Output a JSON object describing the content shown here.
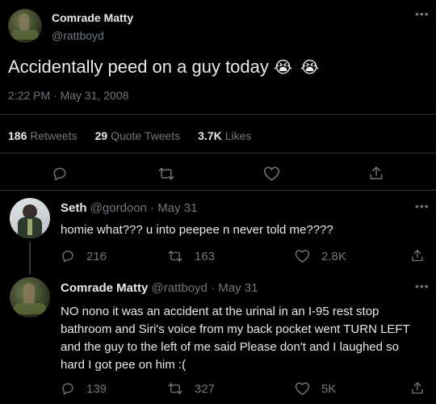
{
  "main_tweet": {
    "author_name": "Comrade Matty",
    "author_handle": "@rattboyd",
    "text": "Accidentally peed on a guy today",
    "emoji": "😭 😭",
    "timestamp": "2:22 PM · May 31, 2008",
    "stats": {
      "retweets_count": "186",
      "retweets_label": "Retweets",
      "quotes_count": "29",
      "quotes_label": "Quote Tweets",
      "likes_count": "3.7K",
      "likes_label": "Likes"
    }
  },
  "replies": [
    {
      "author_name": "Seth",
      "author_handle": "@gordoon",
      "date": "· May 31",
      "text": "homie what??? u into peepee n never told me????",
      "replies_count": "216",
      "retweets_count": "163",
      "likes_count": "2.8K"
    },
    {
      "author_name": "Comrade Matty",
      "author_handle": "@rattboyd",
      "date": "· May 31",
      "text": "NO nono it was an accident at the urinal in an I-95 rest stop bathroom and Siri's voice from my back pocket went TURN LEFT and the guy to the left of me said Please don't and I laughed so hard I got pee on him :(",
      "replies_count": "139",
      "retweets_count": "327",
      "likes_count": "5K"
    }
  ],
  "icons": {
    "more": "more-dots-icon",
    "reply": "reply-bubble-icon",
    "retweet": "retweet-arrows-icon",
    "like": "heart-icon",
    "share": "share-upload-icon"
  },
  "colors": {
    "background": "#000000",
    "text": "#e7e9ea",
    "muted": "#71767b",
    "divider": "#2f3336"
  }
}
